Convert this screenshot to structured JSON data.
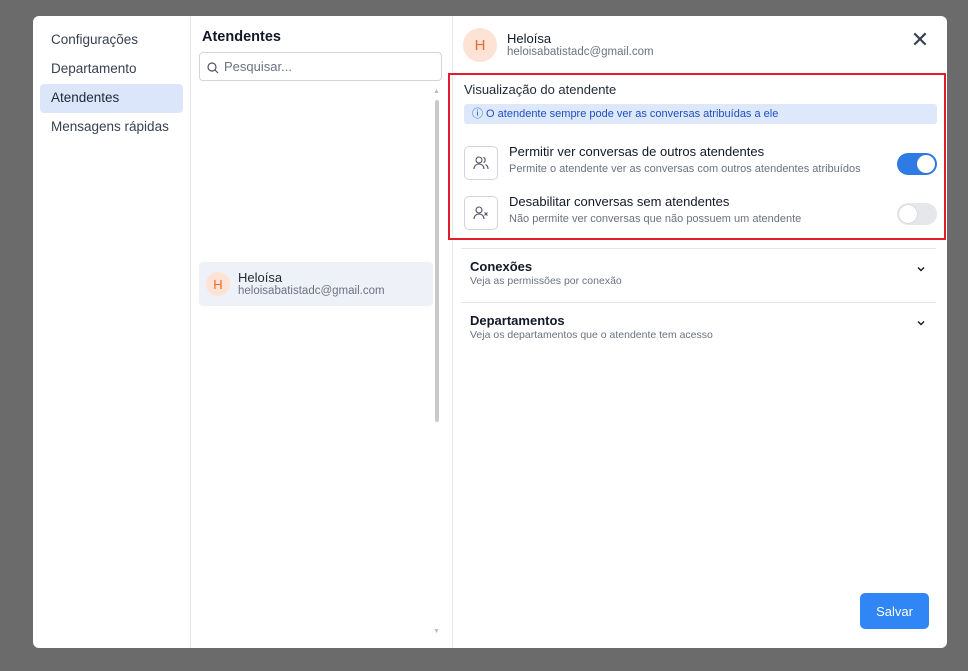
{
  "sidebar": {
    "items": [
      {
        "label": "Configurações"
      },
      {
        "label": "Departamento"
      },
      {
        "label": "Atendentes"
      },
      {
        "label": "Mensagens rápidas"
      }
    ],
    "active": "Atendentes"
  },
  "list": {
    "title": "Atendentes",
    "search_placeholder": "Pesquisar...",
    "items": [
      {
        "initial": "H",
        "name": "Heloísa",
        "email": "heloisabatistadc@gmail.com"
      }
    ]
  },
  "detail": {
    "initial": "H",
    "name": "Heloísa",
    "email": "heloisabatistadc@gmail.com",
    "close_icon": "close-icon",
    "visibility": {
      "title": "Visualização do atendente",
      "info": "ⓘ O atendente sempre pode ver as conversas atribuídas a ele",
      "options": [
        {
          "title": "Permitir ver conversas de outros atendentes",
          "desc": "Permite o atendente ver as conversas com outros atendentes atribuídos",
          "icon": "users-icon",
          "enabled": true
        },
        {
          "title": "Desabilitar conversas sem atendentes",
          "desc": "Não permite ver conversas que não possuem um atendente",
          "icon": "user-x-icon",
          "enabled": false
        }
      ]
    },
    "accordions": [
      {
        "title": "Conexões",
        "desc": "Veja as permissões por conexão"
      },
      {
        "title": "Departamentos",
        "desc": "Veja os departamentos que o atendente tem acesso"
      }
    ],
    "save_label": "Salvar"
  },
  "colors": {
    "accent": "#2f7be5",
    "highlight_border": "#e11d2a",
    "avatar_bg": "#fde3d6",
    "avatar_fg": "#ea6a2c"
  }
}
